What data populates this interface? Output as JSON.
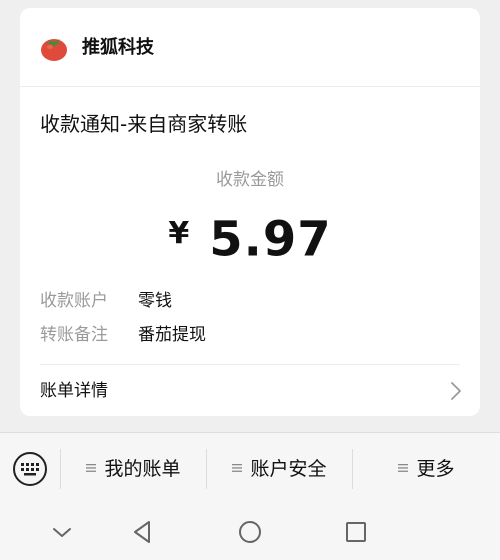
{
  "header": {
    "brand_name": "推狐科技",
    "logo_icon": "tomato-icon"
  },
  "notice": {
    "title": "收款通知-来自商家转账",
    "amount_label": "收款金额",
    "currency_symbol": "¥",
    "amount": "5.97"
  },
  "details": [
    {
      "label": "收款账户",
      "value": "零钱"
    },
    {
      "label": "转账备注",
      "value": "番茄提现"
    }
  ],
  "bill_detail": {
    "label": "账单详情",
    "icon": "chevron-right-icon"
  },
  "menu": {
    "keyboard_icon": "keyboard-icon",
    "items": [
      {
        "label": "我的账单"
      },
      {
        "label": "账户安全"
      },
      {
        "label": "更多"
      }
    ]
  },
  "nav": {
    "icons": [
      "chevron-down-icon",
      "back-triangle-icon",
      "home-circle-icon",
      "recents-square-icon"
    ]
  },
  "colors": {
    "background": "#efefef",
    "card": "#ffffff",
    "secondary_text": "#9a9a9a",
    "tomato_red": "#e04a3a",
    "tomato_leaf": "#3f8f3a"
  }
}
